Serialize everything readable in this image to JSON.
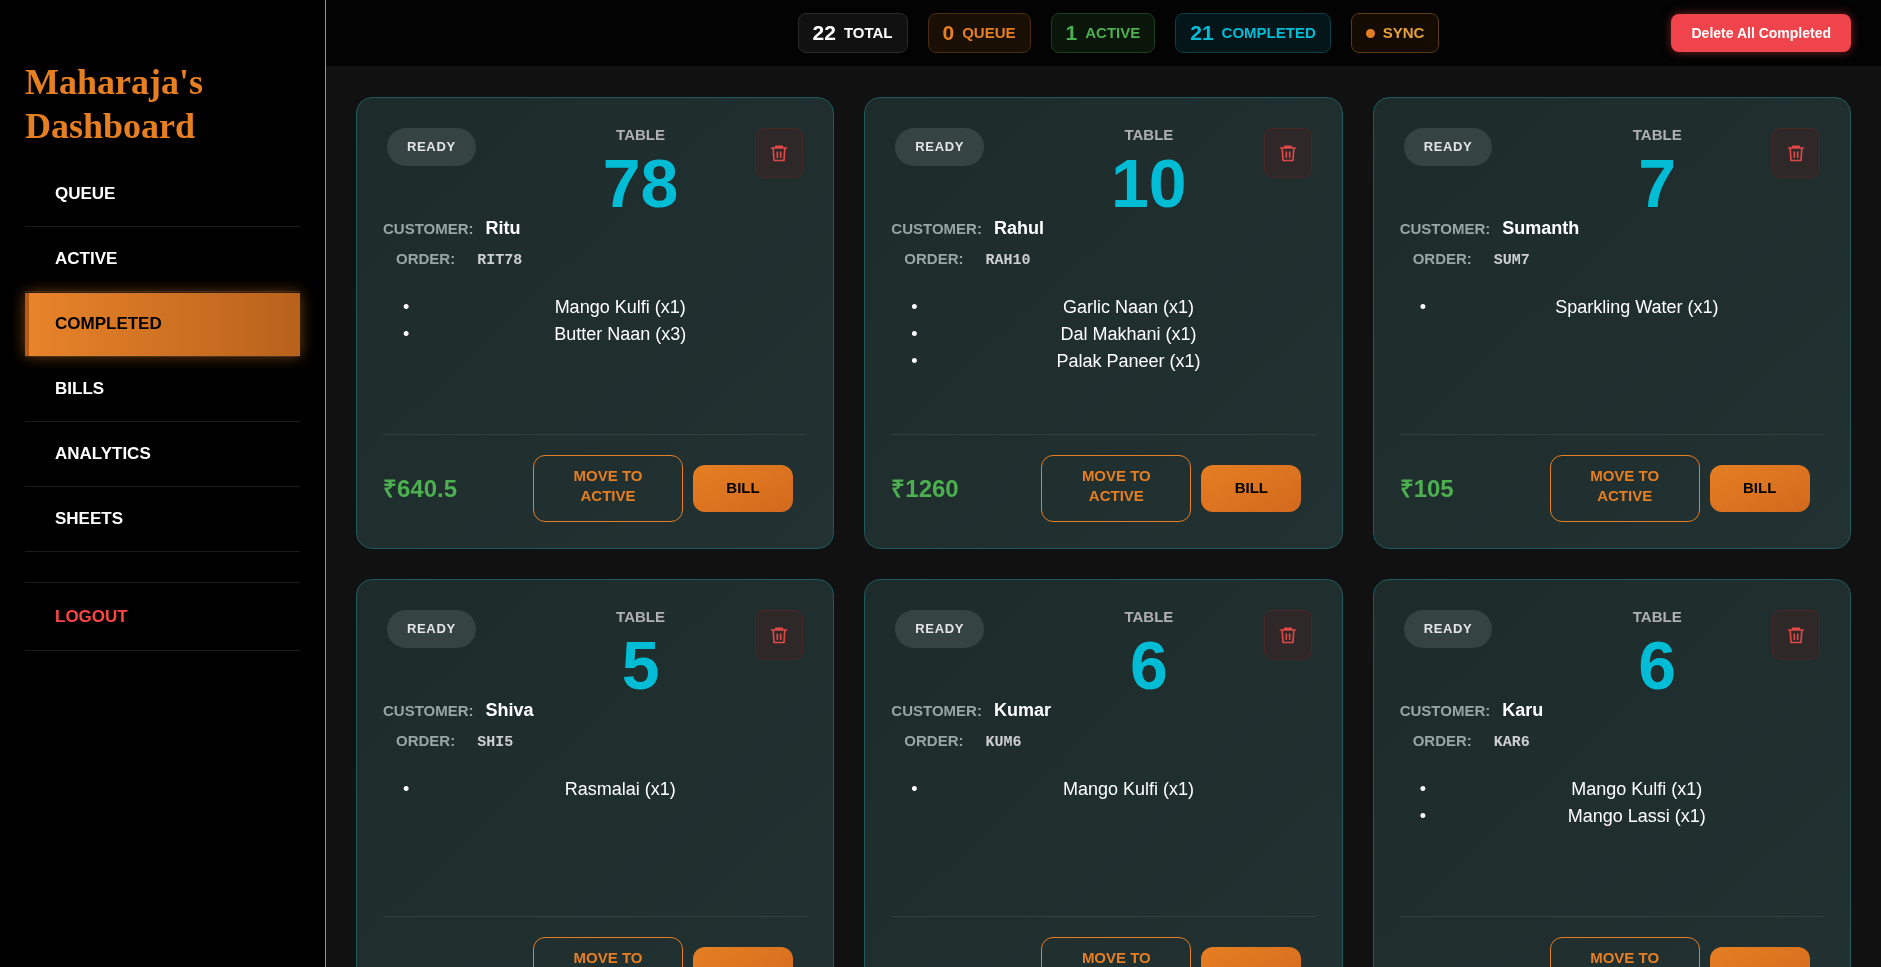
{
  "sidebar": {
    "title": "Maharaja's Dashboard",
    "items": [
      {
        "label": "QUEUE",
        "selected": false
      },
      {
        "label": "ACTIVE",
        "selected": false
      },
      {
        "label": "COMPLETED",
        "selected": true
      },
      {
        "label": "BILLS",
        "selected": false
      },
      {
        "label": "ANALYTICS",
        "selected": false
      },
      {
        "label": "SHEETS",
        "selected": false
      }
    ],
    "logout": "LOGOUT"
  },
  "stats": [
    {
      "kind": "total",
      "count": "22",
      "label": "TOTAL"
    },
    {
      "kind": "queue",
      "count": "0",
      "label": "QUEUE"
    },
    {
      "kind": "active",
      "count": "1",
      "label": "ACTIVE"
    },
    {
      "kind": "completed",
      "count": "21",
      "label": "COMPLETED"
    },
    {
      "kind": "sync",
      "label": "SYNC"
    }
  ],
  "delete_button": "Delete All Completed",
  "orders": [
    {
      "status": "READY",
      "table_label": "TABLE",
      "table": "78",
      "customer_label": "CUSTOMER:",
      "customer": "Ritu",
      "order_label": "ORDER:",
      "order": "RIT78",
      "items": [
        {
          "marker": "•",
          "text": "Mango Kulfi (x1)"
        },
        {
          "marker": "•",
          "text": "Butter Naan (x3)"
        }
      ],
      "price": "₹640.5",
      "move_label": "MOVE TO ACTIVE",
      "bill_label": "BILL"
    },
    {
      "status": "READY",
      "table_label": "TABLE",
      "table": "10",
      "customer_label": "CUSTOMER:",
      "customer": "Rahul",
      "order_label": "ORDER:",
      "order": "RAH10",
      "items": [
        {
          "marker": "•",
          "text": "Garlic Naan (x1)"
        },
        {
          "marker": "•",
          "text": "Dal Makhani (x1)"
        },
        {
          "marker": "•",
          "text": "Palak Paneer (x1)"
        }
      ],
      "price": "₹1260",
      "move_label": "MOVE TO ACTIVE",
      "bill_label": "BILL"
    },
    {
      "status": "READY",
      "table_label": "TABLE",
      "table": "7",
      "customer_label": "CUSTOMER:",
      "customer": "Sumanth",
      "order_label": "ORDER:",
      "order": "SUM7",
      "items": [
        {
          "marker": "•",
          "text": "Sparkling Water (x1)"
        }
      ],
      "price": "₹105",
      "move_label": "MOVE TO ACTIVE",
      "bill_label": "BILL"
    },
    {
      "status": "READY",
      "table_label": "TABLE",
      "table": "5",
      "customer_label": "CUSTOMER:",
      "customer": "Shiva",
      "order_label": "ORDER:",
      "order": "SHI5",
      "items": [
        {
          "marker": "•",
          "text": "Rasmalai (x1)"
        }
      ],
      "move_label": "MOVE TO"
    },
    {
      "status": "READY",
      "table_label": "TABLE",
      "table": "6",
      "customer_label": "CUSTOMER:",
      "customer": "Kumar",
      "order_label": "ORDER:",
      "order": "KUM6",
      "items": [
        {
          "marker": "•",
          "text": "Mango Kulfi (x1)"
        }
      ],
      "move_label": "MOVE TO"
    },
    {
      "status": "READY",
      "table_label": "TABLE",
      "table": "6",
      "customer_label": "CUSTOMER:",
      "customer": "Karu",
      "order_label": "ORDER:",
      "order": "KAR6",
      "items": [
        {
          "marker": "•",
          "text": "Mango Kulfi (x1)"
        },
        {
          "marker": "•",
          "text": "Mango Lassi (x1)"
        }
      ],
      "move_label": "MOVE TO"
    }
  ]
}
